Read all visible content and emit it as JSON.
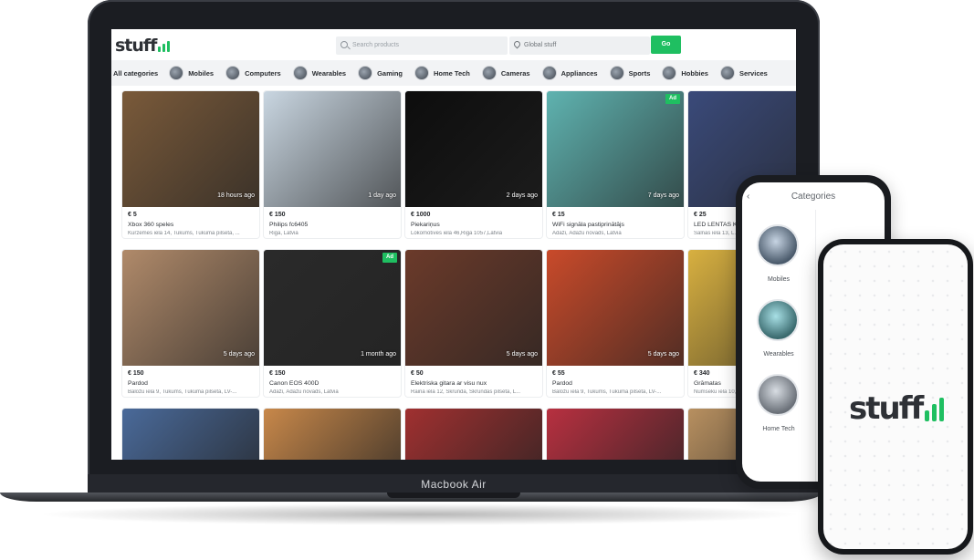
{
  "laptop": {
    "brand": "Macbook Air",
    "logo_text": "stuff",
    "search": {
      "placeholder": "Search products"
    },
    "location": {
      "value": "Global stuff"
    },
    "go_label": "Go",
    "categories": [
      "All categories",
      "Mobiles",
      "Computers",
      "Wearables",
      "Gaming",
      "Home Tech",
      "Cameras",
      "Appliances",
      "Sports",
      "Hobbies",
      "Services"
    ],
    "listings": [
      {
        "price": "€ 5",
        "title": "Xbox 360 speles",
        "address": "Kurzemes iela 14, Tukums, Tukuma pilsēta, ...",
        "ago": "18 hours ago",
        "ad": "",
        "color": "#7a5a3a"
      },
      {
        "price": "€ 150",
        "title": "Philips fc6405",
        "address": "Riga, Latvia",
        "ago": "1 day ago",
        "ad": "",
        "color": "#c9d6e1"
      },
      {
        "price": "€ 1000",
        "title": "Piekariņus",
        "address": "Lokomotīves iela 46,Riga 1057,Latvia",
        "ago": "2 days ago",
        "ad": "",
        "color": "#0d0d0d"
      },
      {
        "price": "€ 15",
        "title": "WiFi signāla pastiprinātājs",
        "address": "Ādaži, Ādažu novads, Latvia",
        "ago": "7 days ago",
        "ad": "Ad",
        "color": "#5fb3b0"
      },
      {
        "price": "€ 25",
        "title": "LED LENTAS KO...",
        "address": "Salnas iela 13, L...",
        "ago": "",
        "ad": "",
        "color": "#3a4a7a"
      },
      {
        "price": "€ 150",
        "title": "Pardod",
        "address": "Baložu iela 9, Tukums, Tukuma pilsēta, LV-...",
        "ago": "5 days ago",
        "ad": "",
        "color": "#b08a6a"
      },
      {
        "price": "€ 150",
        "title": "Canon EOS 400D",
        "address": "Ādaži, Ādažu novads, Latvia",
        "ago": "1 month ago",
        "ad": "Ad",
        "color": "#2a2a2a"
      },
      {
        "price": "€ 50",
        "title": "Elektriska gitara ar visu nux",
        "address": "Raina iela 12, Skrunda, Skrundas pilsēta, L...",
        "ago": "5 days ago",
        "ad": "",
        "color": "#6b3a2a"
      },
      {
        "price": "€ 55",
        "title": "Pardod",
        "address": "Baložu iela 9, Tukums, Tukuma pilsēta, LV-...",
        "ago": "5 days ago",
        "ad": "",
        "color": "#c94a2a"
      },
      {
        "price": "€ 340",
        "title": "Grāmatas",
        "address": "Nūmseku iela 10, ...",
        "ago": "",
        "ad": "",
        "color": "#d8b040"
      },
      {
        "price": "",
        "title": "",
        "address": "",
        "ago": "",
        "ad": "",
        "color": "#4a6a9a"
      },
      {
        "price": "",
        "title": "",
        "address": "",
        "ago": "",
        "ad": "",
        "color": "#c8884a"
      },
      {
        "price": "",
        "title": "",
        "address": "",
        "ago": "",
        "ad": "",
        "color": "#a03030"
      },
      {
        "price": "",
        "title": "",
        "address": "",
        "ago": "",
        "ad": "",
        "color": "#b83040"
      },
      {
        "price": "",
        "title": "",
        "address": "",
        "ago": "",
        "ad": "",
        "color": "#b89060"
      }
    ]
  },
  "phone_back": {
    "header": "Categories",
    "back_icon": "chevron-left-icon",
    "items": [
      "Mobiles",
      "Wearables",
      "Home Tech"
    ]
  },
  "phone_front": {
    "logo_text": "stuff"
  },
  "colors": {
    "accent": "#1fbf61",
    "dark": "#2e3136"
  }
}
